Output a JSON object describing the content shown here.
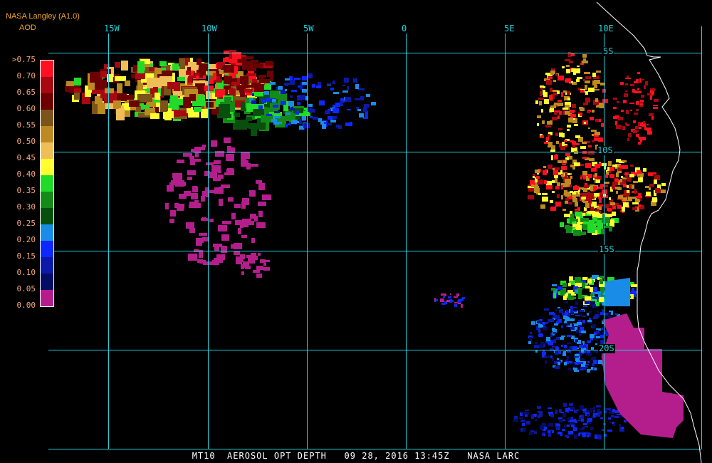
{
  "header": {
    "source": "NASA Langley (A1.0)",
    "product": "AOD"
  },
  "footer": {
    "caption": "MT10  AEROSOL OPT DEPTH   09 28, 2016 13:45Z   NASA LARC"
  },
  "longitude_labels": [
    "15W",
    "10W",
    "5W",
    "0",
    "5E",
    "10E"
  ],
  "latitude_labels": [
    "5S",
    "10S",
    "15S",
    "20S"
  ],
  "legend": {
    "labels": [
      ">0.75",
      "0.70",
      "0.65",
      "0.60",
      "0.55",
      "0.50",
      "0.45",
      "0.40",
      "0.35",
      "0.30",
      "0.25",
      "0.20",
      "0.15",
      "0.10",
      "0.05",
      "0.00"
    ],
    "colors": [
      "#ff1020",
      "#a80810",
      "#6c0000",
      "#7a5418",
      "#bc8a20",
      "#f0be58",
      "#ffff30",
      "#20dc28",
      "#148a18",
      "#084e0c",
      "#188ce6",
      "#0c28ff",
      "#0c18a8",
      "#060c64",
      "#b41e8c"
    ]
  },
  "colors": {
    "grid": "#22d3e0",
    "coast": "#ffffff",
    "header": "#f5a623"
  }
}
